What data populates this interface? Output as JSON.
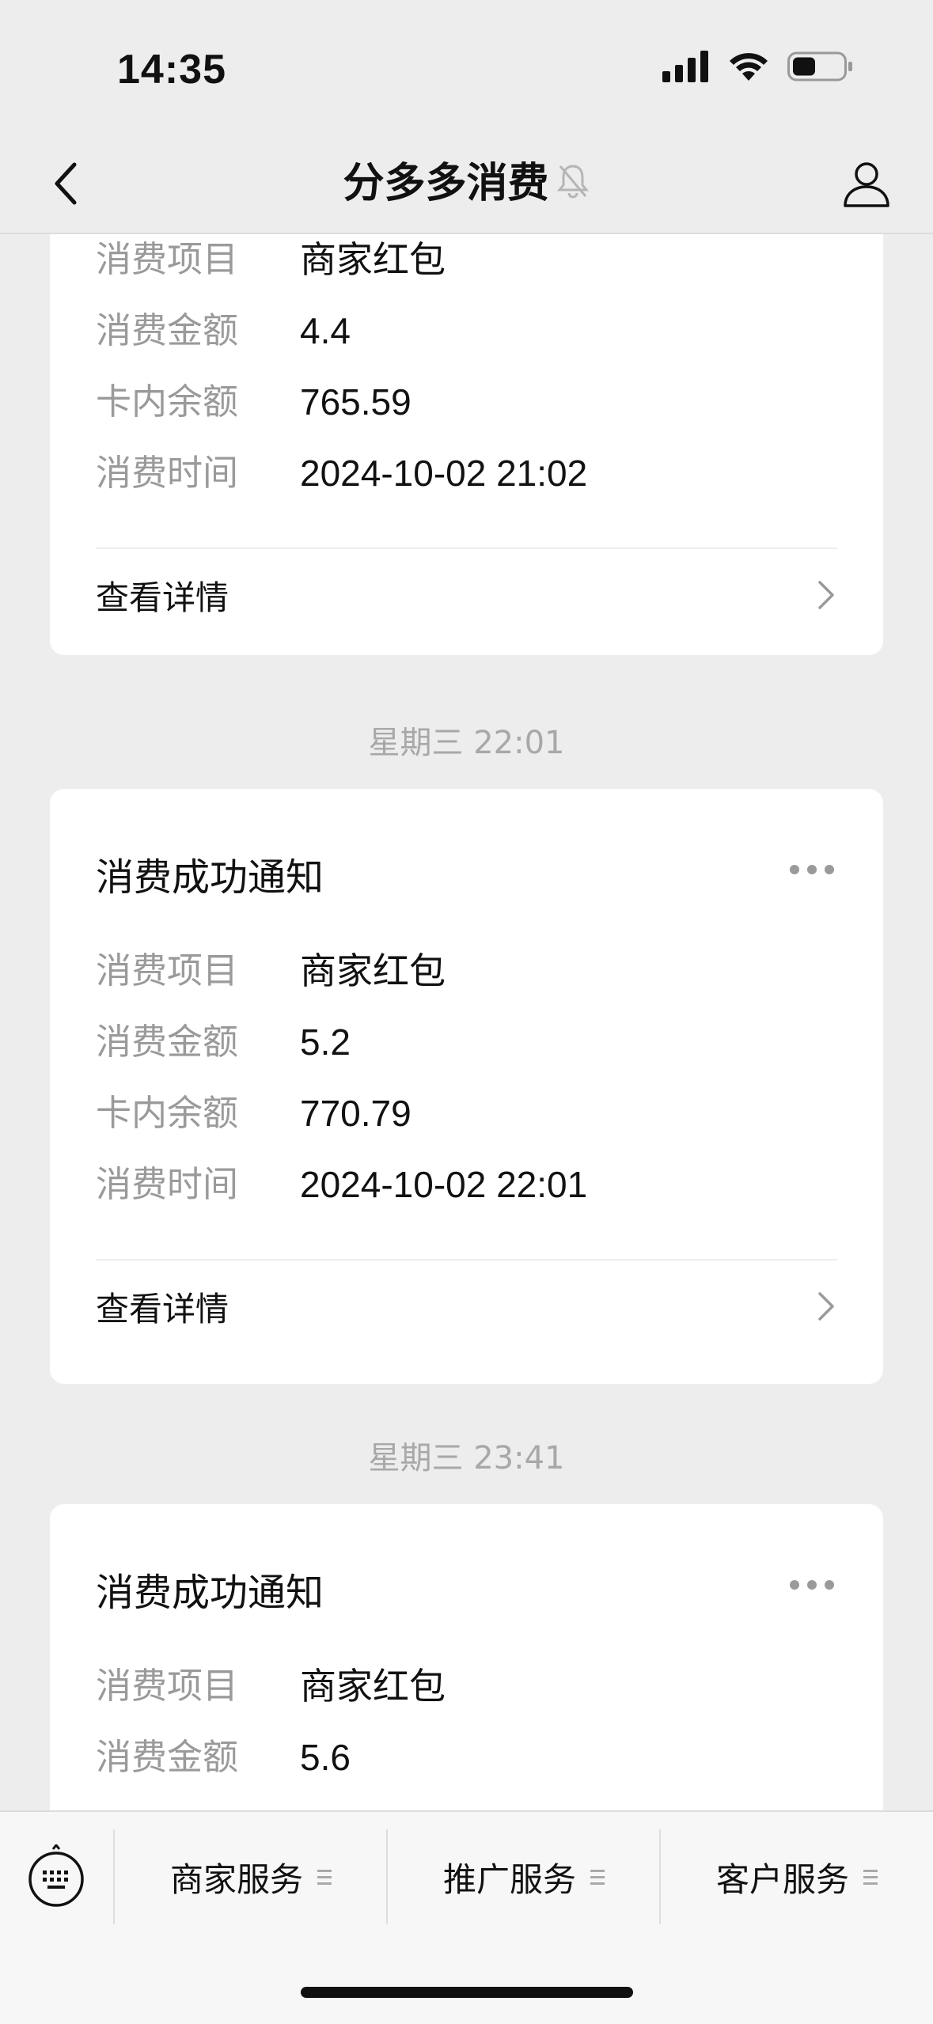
{
  "status_bar": {
    "time": "14:35"
  },
  "nav": {
    "title": "分多多消费"
  },
  "cards": [
    {
      "rows": [
        {
          "label": "消费项目",
          "value": "商家红包"
        },
        {
          "label": "消费金额",
          "value": "4.4"
        },
        {
          "label": "卡内余额",
          "value": "765.59"
        },
        {
          "label": "消费时间",
          "value": "2024-10-02 21:02"
        }
      ],
      "detail_label": "查看详情"
    },
    {
      "timestamp": "星期三 22:01",
      "title": "消费成功通知",
      "rows": [
        {
          "label": "消费项目",
          "value": "商家红包"
        },
        {
          "label": "消费金额",
          "value": "5.2"
        },
        {
          "label": "卡内余额",
          "value": "770.79"
        },
        {
          "label": "消费时间",
          "value": "2024-10-02 22:01"
        }
      ],
      "detail_label": "查看详情"
    },
    {
      "timestamp": "星期三 23:41",
      "title": "消费成功通知",
      "rows": [
        {
          "label": "消费项目",
          "value": "商家红包"
        },
        {
          "label": "消费金额",
          "value": "5.6"
        }
      ]
    }
  ],
  "bottom_menu": {
    "items": [
      {
        "label": "商家服务"
      },
      {
        "label": "推广服务"
      },
      {
        "label": "客户服务"
      }
    ]
  },
  "icons": {
    "back": "chevron-left-icon",
    "mute": "bell-slash-icon",
    "user": "person-icon",
    "more": "ellipsis-icon",
    "detail": "chevron-right-icon",
    "keyboard": "keyboard-icon",
    "menu": "hamburger-icon"
  }
}
